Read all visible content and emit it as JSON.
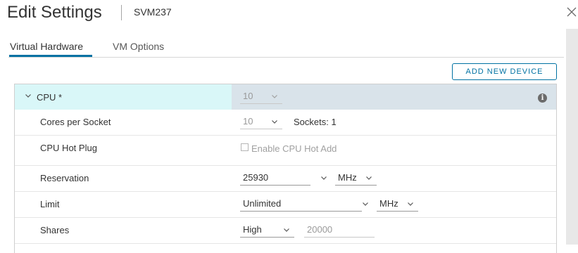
{
  "header": {
    "title": "Edit Settings",
    "vm_name": "SVM237"
  },
  "tabs": [
    {
      "label": "Virtual Hardware",
      "active": true
    },
    {
      "label": "VM Options",
      "active": false
    }
  ],
  "toolbar": {
    "add_device_label": "ADD NEW DEVICE"
  },
  "cpu": {
    "label": "CPU *",
    "value": "10",
    "cores_per_socket": {
      "label": "Cores per Socket",
      "value": "10",
      "sockets_text": "Sockets: 1"
    },
    "hot_plug": {
      "label": "CPU Hot Plug",
      "checkbox_label": "Enable CPU Hot Add",
      "checked": false
    },
    "reservation": {
      "label": "Reservation",
      "value": "25930",
      "unit": "MHz"
    },
    "limit": {
      "label": "Limit",
      "value": "Unlimited",
      "unit": "MHz"
    },
    "shares": {
      "label": "Shares",
      "value": "High",
      "amount": "20000"
    }
  },
  "colors": {
    "accent": "#0072a3",
    "header_bg": "#d9e3ea",
    "header_left_bg": "#d9f7f8"
  }
}
